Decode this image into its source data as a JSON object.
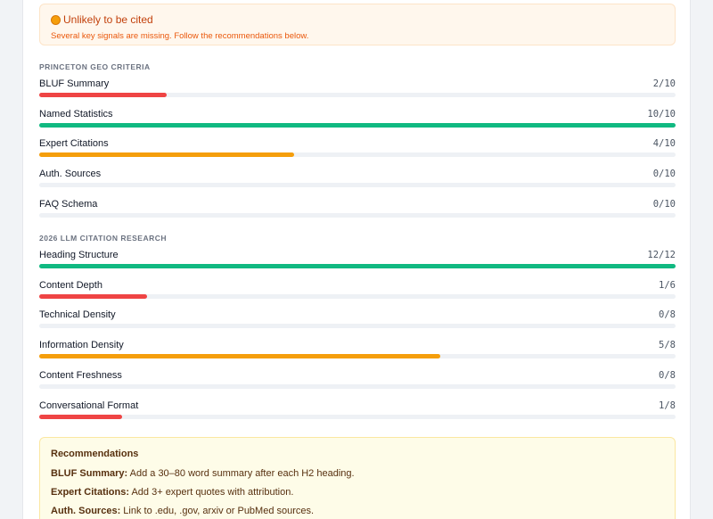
{
  "alert": {
    "title": "Unlikely to be cited",
    "subtitle": "Several key signals are missing. Follow the recommendations below.",
    "icon": "orange-circle-icon",
    "color": "#c2410c"
  },
  "sections": [
    {
      "heading": "PRINCETON GEO CRITERIA",
      "rows": [
        {
          "label": "BLUF Summary",
          "score": "2/10",
          "value": 0.2,
          "color": "#ef4444"
        },
        {
          "label": "Named Statistics",
          "score": "10/10",
          "value": 1.0,
          "color": "#10b981"
        },
        {
          "label": "Expert Citations",
          "score": "4/10",
          "value": 0.4,
          "color": "#f59e0b"
        },
        {
          "label": "Auth. Sources",
          "score": "0/10",
          "value": 0,
          "color": "#ef4444"
        },
        {
          "label": "FAQ Schema",
          "score": "0/10",
          "value": 0,
          "color": "#ef4444"
        }
      ]
    },
    {
      "heading": "2026 LLM CITATION RESEARCH",
      "rows": [
        {
          "label": "Heading Structure",
          "score": "12/12",
          "value": 1.0,
          "color": "#10b981"
        },
        {
          "label": "Content Depth",
          "score": "1/6",
          "value": 0.17,
          "color": "#ef4444"
        },
        {
          "label": "Technical Density",
          "score": "0/8",
          "value": 0,
          "color": "#ef4444"
        },
        {
          "label": "Information Density",
          "score": "5/8",
          "value": 0.63,
          "color": "#f59e0b"
        },
        {
          "label": "Content Freshness",
          "score": "0/8",
          "value": 0,
          "color": "#ef4444"
        },
        {
          "label": "Conversational Format",
          "score": "1/8",
          "value": 0.13,
          "color": "#ef4444"
        }
      ]
    }
  ],
  "recommendations": {
    "title": "Recommendations",
    "items": [
      {
        "key": "BLUF Summary:",
        "text": " Add a 30–80 word summary after each H2 heading."
      },
      {
        "key": "Expert Citations:",
        "text": " Add 3+ expert quotes with attribution."
      },
      {
        "key": "Auth. Sources:",
        "text": " Link to .edu, .gov, arxiv or PubMed sources."
      }
    ]
  }
}
